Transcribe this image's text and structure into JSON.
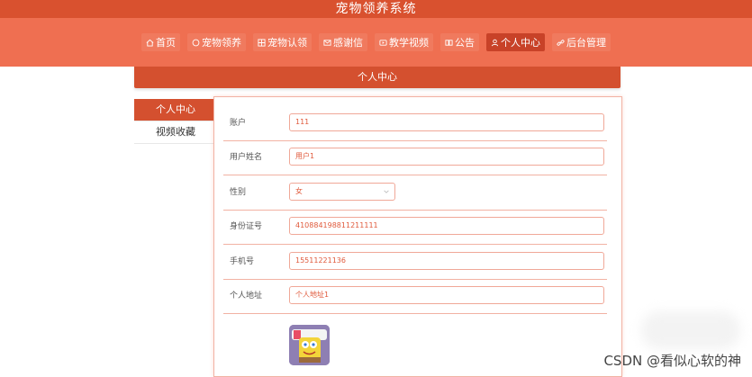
{
  "app": {
    "title": "宠物领养系统"
  },
  "nav": {
    "items": [
      {
        "label": "首页",
        "icon": "home-icon"
      },
      {
        "label": "宠物领养",
        "icon": "circle-icon"
      },
      {
        "label": "宠物认领",
        "icon": "grid-icon"
      },
      {
        "label": "感谢信",
        "icon": "mail-icon"
      },
      {
        "label": "教学视频",
        "icon": "video-icon"
      },
      {
        "label": "公告",
        "icon": "notice-icon"
      },
      {
        "label": "个人中心",
        "icon": "user-icon",
        "active": true
      },
      {
        "label": "后台管理",
        "icon": "link-icon"
      }
    ]
  },
  "page": {
    "header": "个人中心"
  },
  "sidebar": {
    "items": [
      {
        "label": "个人中心",
        "active": true
      },
      {
        "label": "视频收藏"
      }
    ]
  },
  "form": {
    "account": {
      "label": "账户",
      "value": "111"
    },
    "name": {
      "label": "用户姓名",
      "value": "用户1"
    },
    "gender": {
      "label": "性别",
      "value": "女"
    },
    "id_number": {
      "label": "身份证号",
      "value": "410884198811211111"
    },
    "phone": {
      "label": "手机号",
      "value": "15511221136"
    },
    "address": {
      "label": "个人地址",
      "value": "个人地址1"
    }
  },
  "watermark": "CSDN @看似心软的神",
  "colors": {
    "accent": "#ef6f51",
    "accent_dark": "#d4502f",
    "border": "#f2b2a3"
  }
}
